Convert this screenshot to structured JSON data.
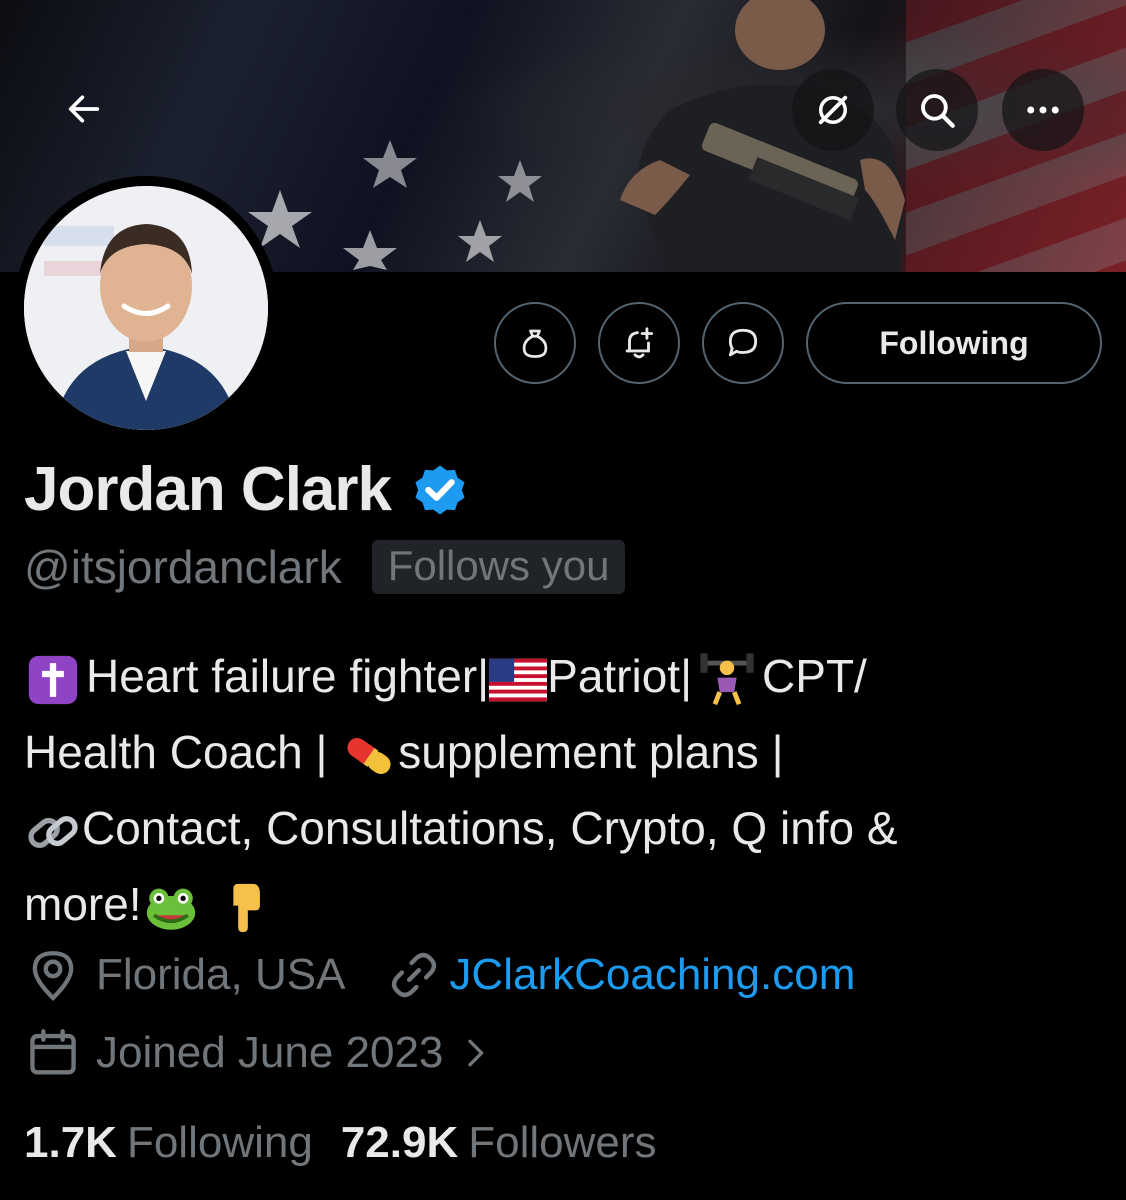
{
  "profile": {
    "name": "Jordan Clark",
    "handle": "@itsjordanclark",
    "follows_you": "Follows you",
    "bio": {
      "line1_a": "Heart failure fighter|",
      "line1_b": "Patriot|",
      "line1_c": "CPT/",
      "line2_a": "Health Coach | ",
      "line2_b": "supplement plans |",
      "line3": "Contact, Consultations, Crypto, Q info &",
      "line4": "more!"
    },
    "location": "Florida, USA",
    "website": "JClarkCoaching.com",
    "joined": "Joined June 2023"
  },
  "stats": {
    "following_count": "1.7K",
    "following_label": "Following",
    "followers_count": "72.9K",
    "followers_label": "Followers"
  },
  "actions": {
    "following_button": "Following"
  },
  "icons": {
    "back": "back-arrow-icon",
    "grok": "grok-icon",
    "search": "search-icon",
    "more": "more-icon",
    "tip": "money-bag-icon",
    "notify": "bell-plus-icon",
    "message": "message-icon",
    "verified": "verified-badge-icon",
    "location": "location-pin-icon",
    "link": "link-icon",
    "calendar": "calendar-icon",
    "chevron": "chevron-right-icon"
  },
  "colors": {
    "background": "#000000",
    "text_primary": "#e7e9ea",
    "text_secondary": "#71767b",
    "link": "#1d9bf0",
    "verified": "#1d9bf0",
    "border": "#536471"
  }
}
